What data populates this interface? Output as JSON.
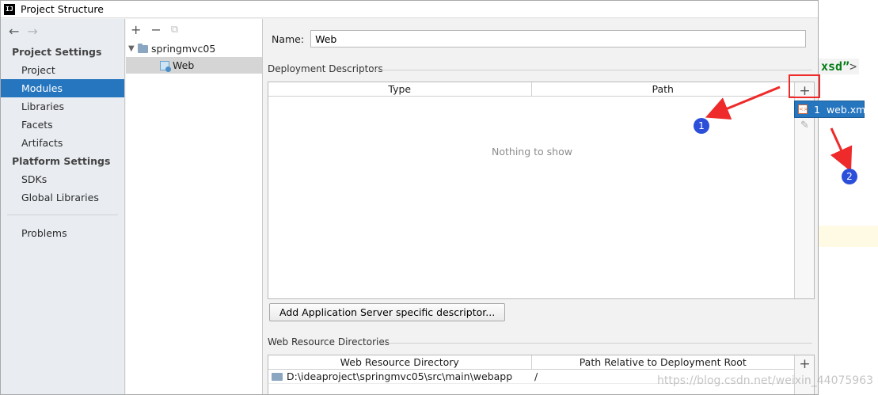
{
  "window": {
    "title": "Project Structure",
    "app_icon": "IJ"
  },
  "background": {
    "code_snippet": "xsd”",
    "code_close": ">"
  },
  "leftnav": {
    "section_project": "Project Settings",
    "project_items": [
      "Project",
      "Modules",
      "Libraries",
      "Facets",
      "Artifacts"
    ],
    "selected": "Modules",
    "section_platform": "Platform Settings",
    "platform_items": [
      "SDKs",
      "Global Libraries"
    ],
    "problems": "Problems"
  },
  "tree": {
    "root": "springmvc05",
    "child": "Web"
  },
  "content": {
    "name_label": "Name:",
    "name_value": "Web",
    "deploy_title": "Deployment Descriptors",
    "deploy_columns": [
      "Type",
      "Path"
    ],
    "empty_message": "Nothing to show",
    "add_button": "Add Application Server specific descriptor...",
    "webres_title": "Web Resource Directories",
    "webres_columns": [
      "Web Resource Directory",
      "Path Relative to Deployment Root"
    ],
    "webres_rows": [
      {
        "dir": "D:\\ideaproject\\springmvc05\\src\\main\\webapp",
        "path": "/"
      }
    ]
  },
  "popup": {
    "index": "1",
    "label": "web.xml"
  },
  "annotations": {
    "badge1": "1",
    "badge2": "2",
    "highlight_color": "#ee2a2a",
    "badge_color": "#2c4fd9"
  },
  "watermark": "https://blog.csdn.net/weixin_44075963",
  "colors": {
    "selection": "#2675bf"
  }
}
